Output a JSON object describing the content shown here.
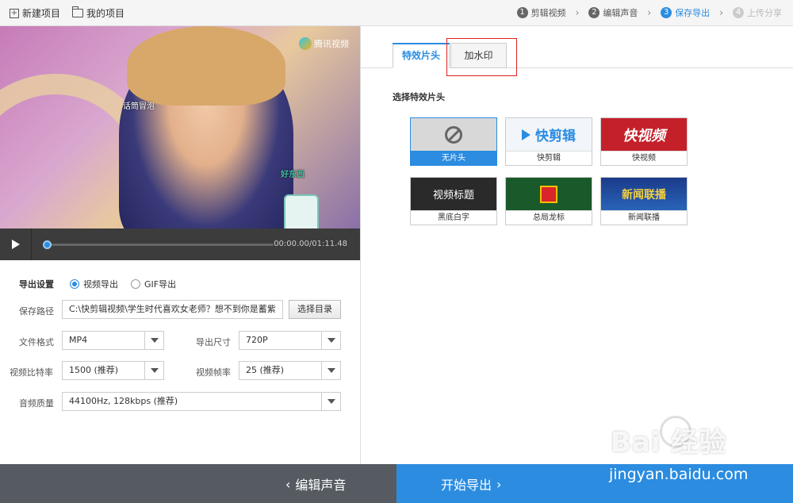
{
  "toolbar": {
    "new_project": "新建项目",
    "my_projects": "我的项目"
  },
  "steps": [
    {
      "num": "1",
      "label": "剪辑视频"
    },
    {
      "num": "2",
      "label": "编辑声音"
    },
    {
      "num": "3",
      "label": "保存导出"
    },
    {
      "num": "4",
      "label": "上传分享"
    }
  ],
  "player": {
    "watermark": "腾讯视频",
    "time": "00:00.00/01:11.48",
    "tag_left": "话筒冒泡",
    "tag_product": "好东西"
  },
  "export": {
    "settings_label": "导出设置",
    "option_video": "视频导出",
    "option_gif": "GIF导出",
    "save_path_label": "保存路径",
    "save_path_value": "C:\\快剪辑视频\\学生时代喜欢女老师？想不到你是蓄紫",
    "choose_dir": "选择目录",
    "format_label": "文件格式",
    "format_value": "MP4",
    "size_label": "导出尺寸",
    "size_value": "720P",
    "bitrate_label": "视频比特率",
    "bitrate_value": "1500 (推荐)",
    "framerate_label": "视频帧率",
    "framerate_value": "25 (推荐)",
    "audio_label": "音频质量",
    "audio_value": "44100Hz, 128kbps (推荐)"
  },
  "tabs": [
    {
      "label": "特效片头"
    },
    {
      "label": "加水印"
    }
  ],
  "intro": {
    "section_title": "选择特效片头",
    "tiles": [
      {
        "caption": "无片头",
        "thumb_text": ""
      },
      {
        "caption": "快剪辑",
        "thumb_text": "快剪辑"
      },
      {
        "caption": "快视频",
        "thumb_text": "快视频"
      },
      {
        "caption": "黑底白字",
        "thumb_text": "视频标题"
      },
      {
        "caption": "总局龙标",
        "thumb_text": ""
      },
      {
        "caption": "新闻联播",
        "thumb_text": "新闻联播"
      }
    ]
  },
  "footer": {
    "back": "编辑声音",
    "start": "开始导出"
  },
  "watermark_overlay": {
    "brand": "Bai 经验",
    "site": "jingyan.baidu.com"
  },
  "colors": {
    "accent": "#2b8ce0",
    "footer_dark": "#555b61",
    "highlight": "#e02020"
  }
}
